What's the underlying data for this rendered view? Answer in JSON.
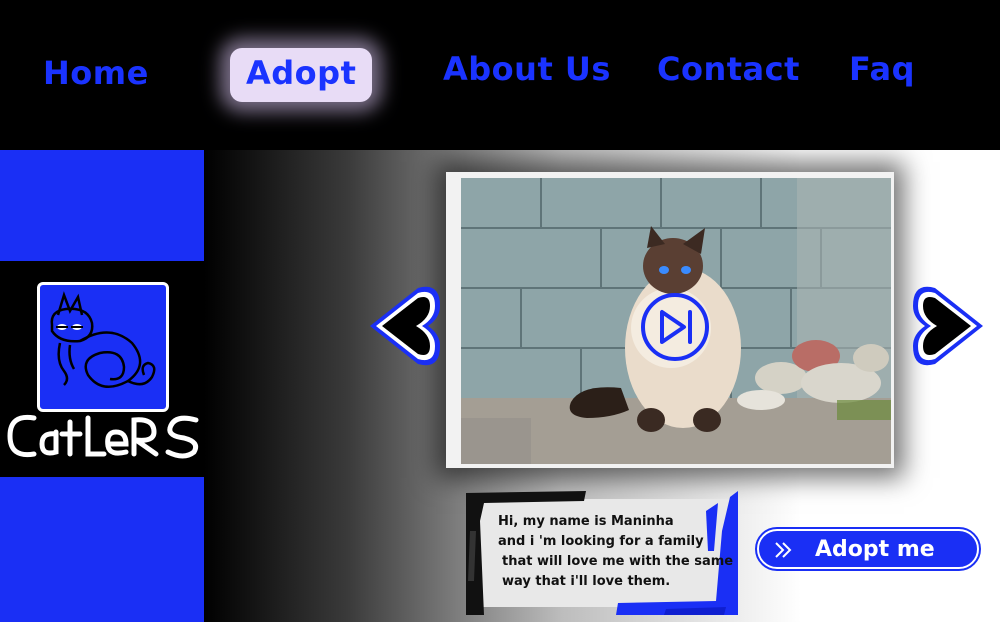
{
  "nav": {
    "home": "Home",
    "adopt": "Adopt",
    "about": "About Us",
    "contact": "Contact",
    "faq": "Faq"
  },
  "brand": {
    "name": "CatLeRS"
  },
  "slider": {
    "prev_icon": "heart-left-arrow-icon",
    "next_icon": "heart-right-arrow-icon",
    "play_icon": "play-pause-icon"
  },
  "bio": {
    "lines": [
      "Hi, my name is Maninha",
      "and i 'm looking for a family",
      "that will love me with the same",
      "way that i'll love them."
    ]
  },
  "cta": {
    "label": "Adopt me",
    "icon": "double-chevron-right-icon"
  },
  "colors": {
    "accent": "#1a2ff5",
    "background": "#000000",
    "highlight": "#e8dcf6"
  }
}
